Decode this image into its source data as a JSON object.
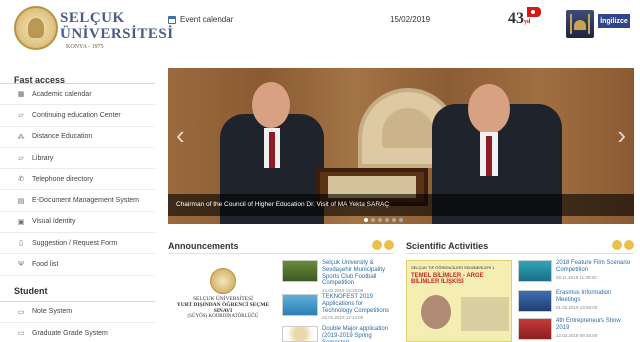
{
  "header": {
    "logo_line1": "SELÇUK",
    "logo_line2": "ÜNİVERSİTESİ",
    "logo_line3": "KONYA - 1975",
    "event_label": "Event calendar",
    "date": "15/02/2019",
    "anniversary": "43",
    "anniversary_suffix": "yıl",
    "language_button": "İngilizce"
  },
  "sidebar": {
    "fast_access_title": "Fast access",
    "items": [
      {
        "label": "Academic calendar",
        "icon": "calendar-icon"
      },
      {
        "label": "Continuing education Center",
        "icon": "book-icon"
      },
      {
        "label": "Distance Education",
        "icon": "network-icon"
      },
      {
        "label": "Library",
        "icon": "book-icon"
      },
      {
        "label": "Telephone directory",
        "icon": "phone-icon"
      },
      {
        "label": "E-Document Management System",
        "icon": "document-icon"
      },
      {
        "label": "Visual Identity",
        "icon": "image-icon"
      },
      {
        "label": "Suggestion / Request Form",
        "icon": "form-icon"
      },
      {
        "label": "Food list",
        "icon": "food-icon"
      }
    ],
    "student_title": "Student",
    "student_items": [
      {
        "label": "Note System",
        "icon": "monitor-icon"
      },
      {
        "label": "Graduate Grade System",
        "icon": "monitor-icon"
      }
    ]
  },
  "slider": {
    "caption": "Chairman of the Council of Higher Education Dr. Visit of MA Yekta SARAÇ",
    "prev_arrow": "‹",
    "next_arrow": "›"
  },
  "announcements": {
    "title": "Announcements",
    "logo_line1": "SELÇUK ÜNİVERSİTESİ",
    "logo_line2": "YURT DIŞINDAN ÖĞRENCİ SEÇME SINAVI",
    "logo_line3": "(SÜYÖS) KOORDİNATÖRLÜĞÜ",
    "items": [
      {
        "text": "Selçuk University & Sevdaşehir Municipality Sports Club Football Competition",
        "date": "14.02.2019 12:18:00"
      },
      {
        "text": "TEKNOFEST 2019 Applications for Technology Competitions",
        "date": "22.01.2019 12:14:00"
      },
      {
        "text": "Double Major application (2019-2019 Spring Semester)",
        "date": ""
      }
    ]
  },
  "scientific": {
    "title": "Scientific Activities",
    "poster_title": "SELÇUK TIP ÖĞRENCİLERİ SEMİNERLERİ 1",
    "poster_headline": "TEMEL BİLİMLER - ARGE BİLİMLER İLİŞKİSİ",
    "items": [
      {
        "text": "2018 Feature Film Scenario Competition",
        "date": "26.11.2019 11:39:00"
      },
      {
        "text": "Erasmus Information Meetings",
        "date": "01.02.2019 13:58:00"
      },
      {
        "text": "4th Entrepreneurs Show 2019",
        "date": "12.02.2019 09:45:00"
      }
    ]
  }
}
